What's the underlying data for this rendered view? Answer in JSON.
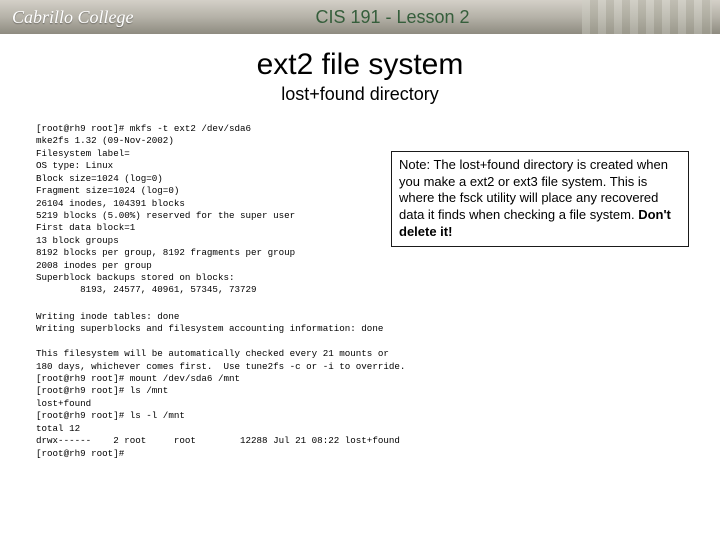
{
  "banner": {
    "logo": "Cabrillo College",
    "title": "CIS 191 - Lesson 2"
  },
  "slide": {
    "title": "ext2 file system",
    "subtitle": "lost+found directory"
  },
  "terminal": {
    "block1": "[root@rh9 root]# mkfs -t ext2 /dev/sda6\nmke2fs 1.32 (09-Nov-2002)\nFilesystem label=\nOS type: Linux\nBlock size=1024 (log=0)\nFragment size=1024 (log=0)\n26104 inodes, 104391 blocks\n5219 blocks (5.00%) reserved for the super user\nFirst data block=1\n13 block groups\n8192 blocks per group, 8192 fragments per group\n2008 inodes per group\nSuperblock backups stored on blocks:\n        8193, 24577, 40961, 57345, 73729",
    "block2": "Writing inode tables: done\nWriting superblocks and filesystem accounting information: done\n\nThis filesystem will be automatically checked every 21 mounts or\n180 days, whichever comes first.  Use tune2fs -c or -i to override.\n[root@rh9 root]# mount /dev/sda6 /mnt\n[root@rh9 root]# ls /mnt\nlost+found\n[root@rh9 root]# ls -l /mnt\ntotal 12\ndrwx------    2 root     root        12288 Jul 21 08:22 lost+found\n[root@rh9 root]#"
  },
  "note": {
    "text_lead": "Note:  The lost+found directory is created when you make a ext2 or ext3 file system.  This is where the fsck utility will place any recovered data it finds when checking a file system. ",
    "emphasis": "Don't delete it!"
  }
}
